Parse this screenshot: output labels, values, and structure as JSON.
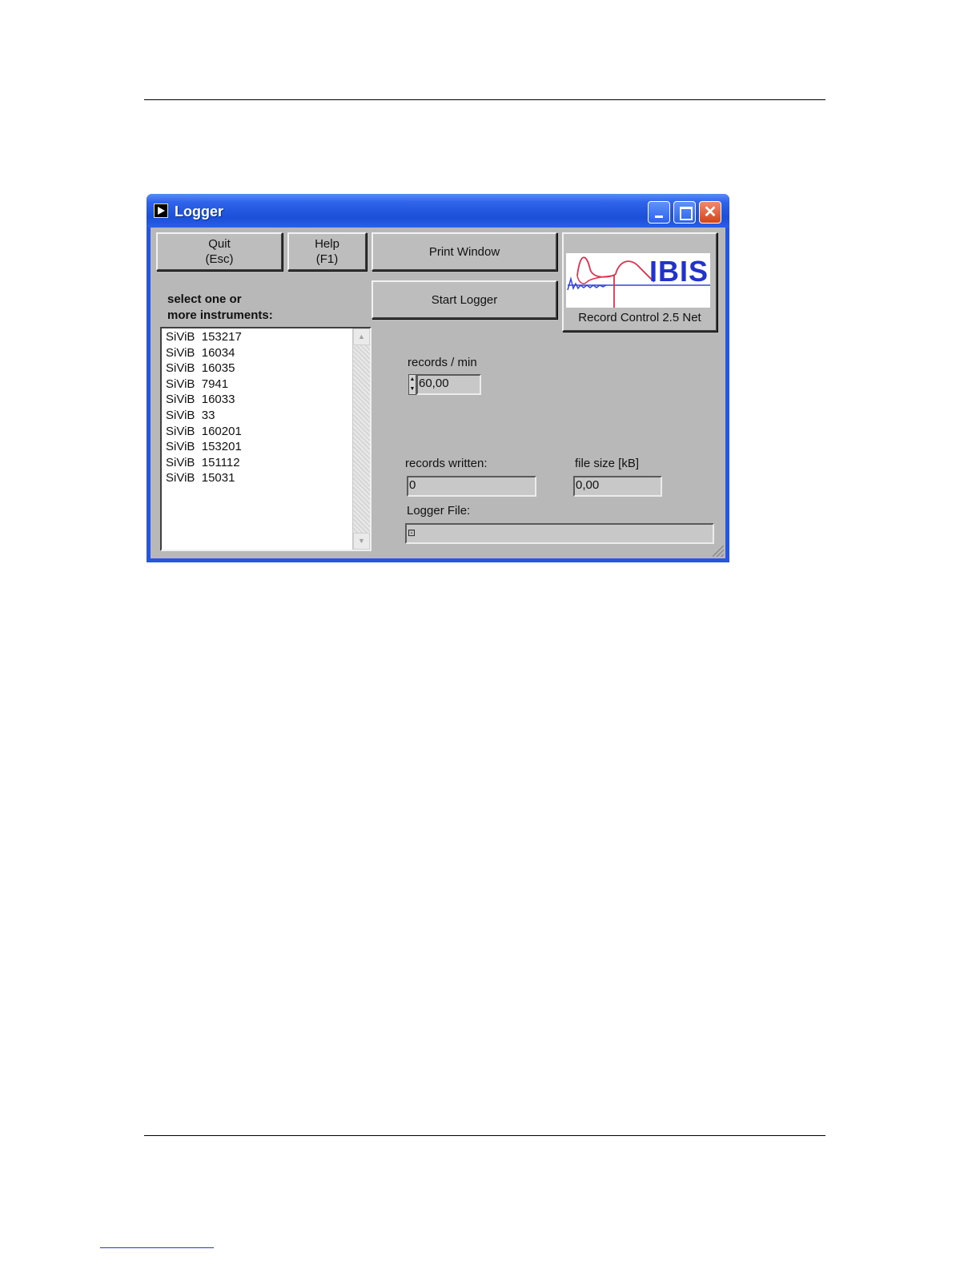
{
  "window": {
    "title": "Logger"
  },
  "buttons": {
    "quit": "Quit\n(Esc)",
    "help": "Help\n(F1)",
    "print_window": "Print Window",
    "start_logger": "Start Logger"
  },
  "instruments": {
    "label": "select one or\nmore instruments:",
    "items": [
      "SiViB  153217",
      "SiViB  16034",
      "SiViB  16035",
      "SiViB  7941",
      "SiViB  16033",
      "SiViB  33",
      "SiViB  160201",
      "SiViB  153201",
      "SiViB  151112",
      "SiViB  15031"
    ]
  },
  "records_per_min": {
    "label": "records / min",
    "value": "60,00"
  },
  "records_written": {
    "label": "records written:",
    "value": "0"
  },
  "file_size": {
    "label": "file size [kB]",
    "value": "0,00"
  },
  "logger_file": {
    "label": "Logger File:",
    "value": ""
  },
  "logo": {
    "brand": "IBIS",
    "caption": "Record Control 2.5 Net"
  },
  "colors": {
    "titlebar": "#2456e0",
    "panel": "#b8b8b8",
    "brand_blue": "#2233cc",
    "brand_red": "#e0304e"
  },
  "icons": {
    "app": "labview-run-icon",
    "minimize": "minimize-icon",
    "maximize": "maximize-icon",
    "close": "close-icon",
    "path": "path-browse-icon"
  }
}
